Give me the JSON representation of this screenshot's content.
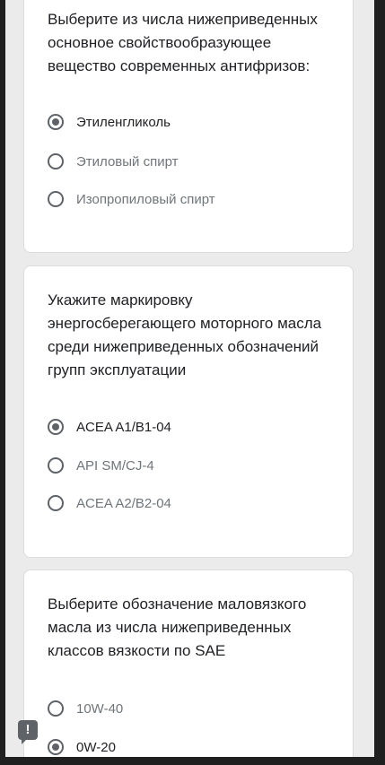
{
  "questions": [
    {
      "text": "Выберите из числа нижеприведенных\nосновное свойствообразующее\nвещество современных антифризов:",
      "options": [
        {
          "label": "Этиленгликоль",
          "selected": true
        },
        {
          "label": "Этиловый спирт",
          "selected": false
        },
        {
          "label": "Изопропиловый спирт",
          "selected": false
        }
      ]
    },
    {
      "text": "Укажите маркировку\nэнергосберегающего моторного масла\nсреди нижеприведенных обозначений\nгрупп эксплуатации",
      "options": [
        {
          "label": "ACEA A1/B1-04",
          "selected": true
        },
        {
          "label": "API SM/CJ-4",
          "selected": false
        },
        {
          "label": "ACEA A2/B2-04",
          "selected": false
        }
      ]
    },
    {
      "text": "Выберите обозначение маловязкого\nмасла из числа нижеприведенных\nклассов вязкости по SAE",
      "options": [
        {
          "label": "10W-40",
          "selected": false
        },
        {
          "label": "0W-20",
          "selected": true
        }
      ]
    }
  ],
  "report_button": {
    "symbol": "!",
    "icon": "report-problem-icon"
  }
}
